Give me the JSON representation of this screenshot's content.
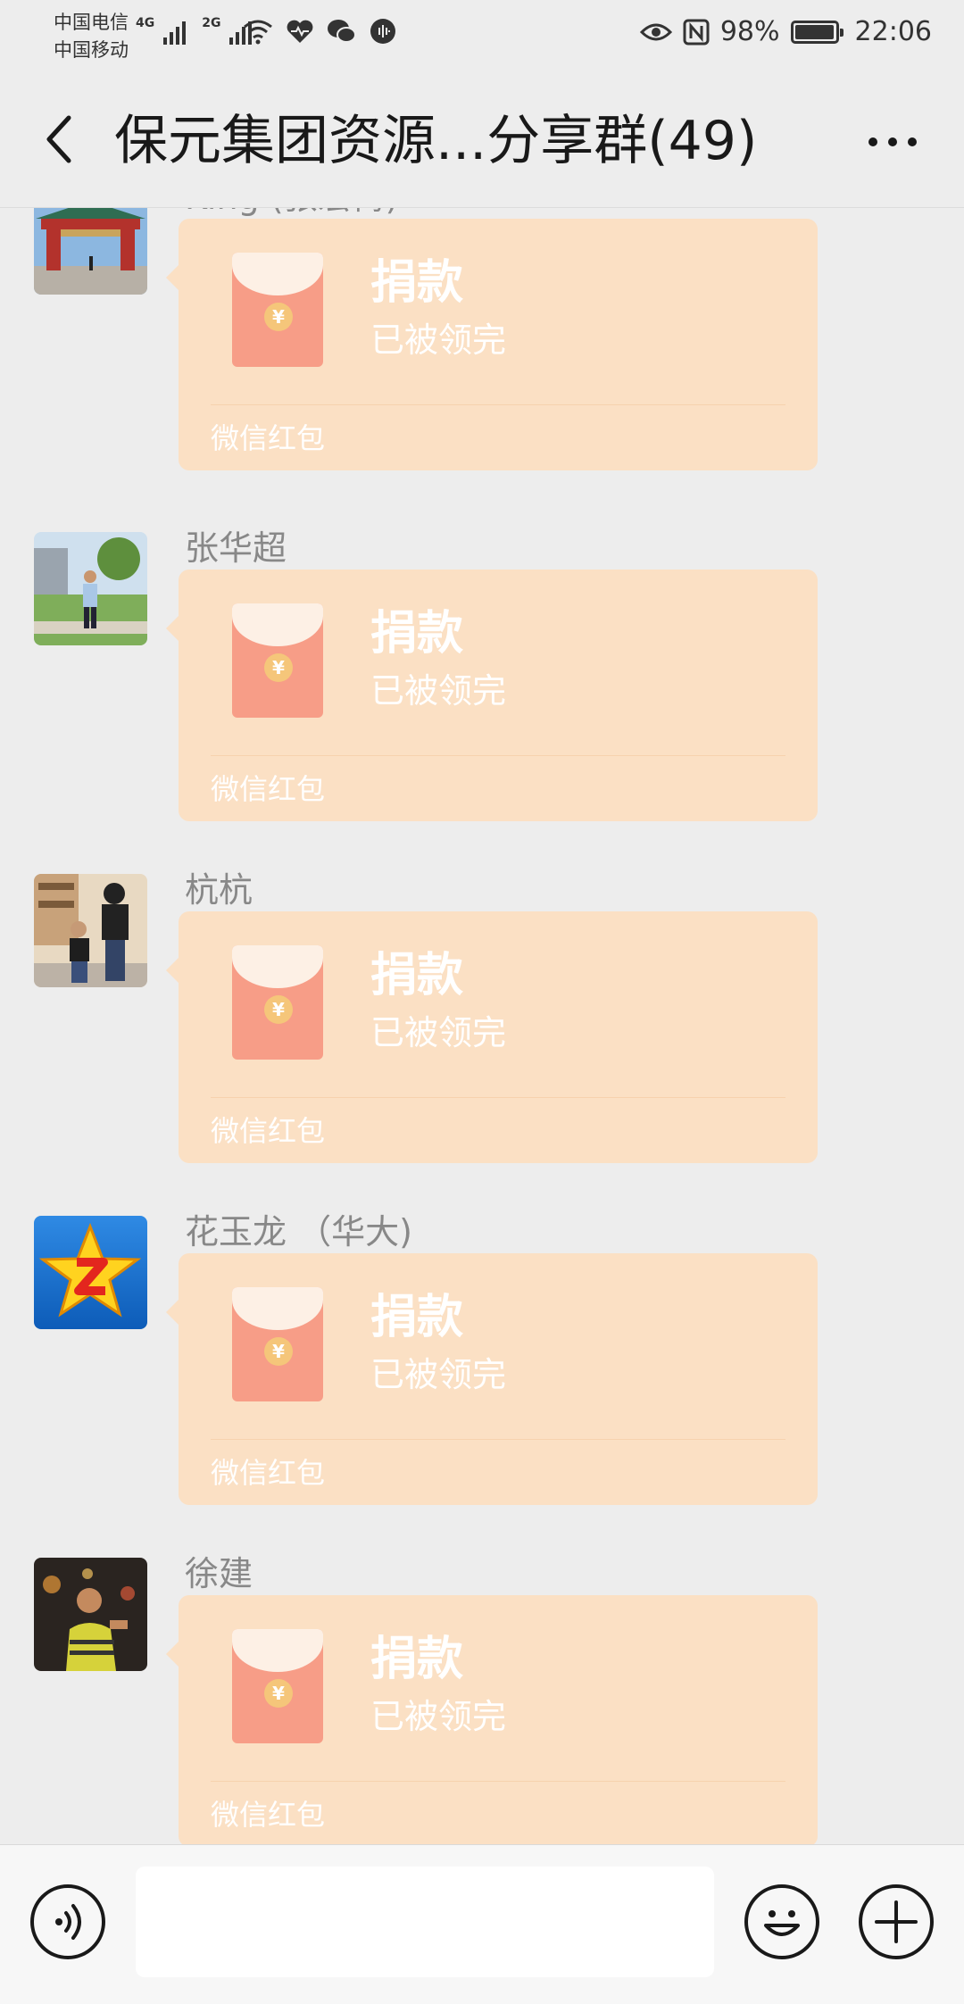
{
  "status_bar": {
    "carrier_1": "中国电信",
    "carrier_2": "中国移动",
    "network_1": "4G",
    "network_2": "2G",
    "battery_percent": "98%",
    "battery_level": 0.98,
    "time": "22:06",
    "icons_left": [
      "signal-icon",
      "wifi-icon",
      "health-icon",
      "wechat-icon",
      "audio-icon"
    ],
    "icons_right": [
      "eye-icon",
      "nfc-icon",
      "battery-icon"
    ]
  },
  "header": {
    "title": "保元集团资源...分享群(49)",
    "back_icon": "chevron-left-icon",
    "more_icon": "more-dots-icon"
  },
  "messages": [
    {
      "sender": "King (张宏梅)",
      "avatar": "gate-photo-avatar",
      "packet_title": "捐款",
      "packet_status": "已被领完",
      "packet_footer": "微信红包"
    },
    {
      "sender": "张华超",
      "avatar": "man-park-avatar",
      "packet_title": "捐款",
      "packet_status": "已被领完",
      "packet_footer": "微信红包"
    },
    {
      "sender": "杭杭",
      "avatar": "family-photo-avatar",
      "packet_title": "捐款",
      "packet_status": "已被领完",
      "packet_footer": "微信红包"
    },
    {
      "sender": "花玉龙 （华大)",
      "avatar": "qq-star-avatar",
      "packet_title": "捐款",
      "packet_status": "已被领完",
      "packet_footer": "微信红包"
    },
    {
      "sender": "徐建",
      "avatar": "man-night-avatar",
      "packet_title": "捐款",
      "packet_status": "已被领完",
      "packet_footer": "微信红包"
    }
  ],
  "input_bar": {
    "voice_icon": "voice-icon",
    "input_value": "",
    "emoji_icon": "emoji-icon",
    "plus_icon": "plus-icon"
  },
  "colors": {
    "background": "#ededed",
    "packet_bg": "#fbe0c4",
    "envelope_red": "#f79d87",
    "coin_gold": "#f5c67a"
  }
}
